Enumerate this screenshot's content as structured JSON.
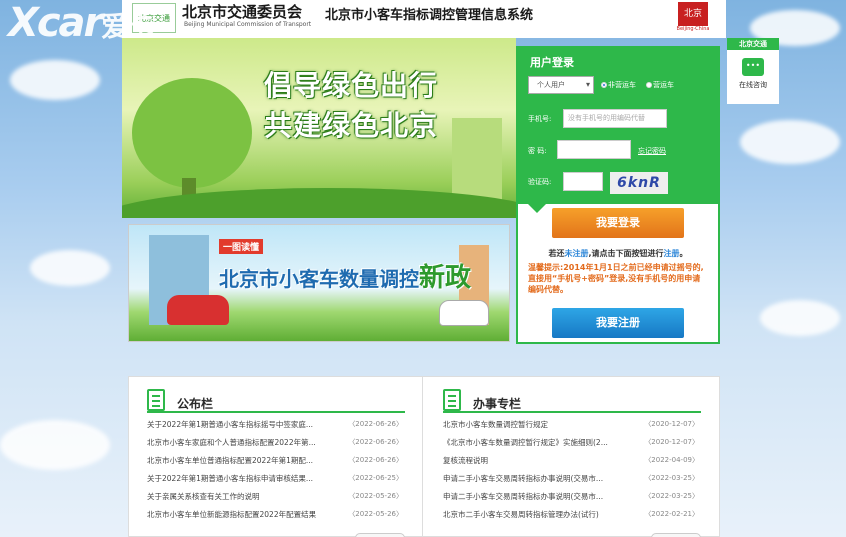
{
  "watermark": {
    "brand": "Xcar",
    "suffix": "爱卡"
  },
  "header": {
    "logo_text": "北京交通",
    "org_name": "北京市交通委员会",
    "org_name_en": "Beijing Municipal Commission of Transport",
    "system_title": "北京市小客车指标调控管理信息系统",
    "city_logo_text": "北京",
    "city_logo_sub": "Beijing·China"
  },
  "banner1": {
    "line1": "倡导绿色出行",
    "line2": "共建绿色北京"
  },
  "banner2": {
    "tag": "一图读懂",
    "headline_prefix": "北京市小客车数量调控",
    "headline_emphasis": "新政"
  },
  "login": {
    "title": "用户登录",
    "user_type": "个人用户",
    "radio_options": [
      "非营运车",
      "营运车"
    ],
    "phone_label": "手机号:",
    "phone_placeholder": "没有手机号的用编码代替",
    "password_label": "密  码:",
    "forgot_link": "忘记密码",
    "captcha_label": "验证码:",
    "captcha_text": "6knR",
    "login_button": "我要登录",
    "register_hint_1": "若还",
    "register_hint_link1": "未注册",
    "register_hint_2": ",请点击下面按钮进行",
    "register_hint_link2": "注册",
    "register_hint_3": "。",
    "warm_tip": "温馨提示:2014年1月1日之前已经申请过摇号的,直接用“手机号+密码”登录,没有手机号的用申请编码代替。",
    "register_button": "我要注册"
  },
  "service": {
    "title": "北京交通",
    "label": "在线咨询"
  },
  "board": {
    "notice": {
      "title": "公布栏",
      "items": [
        {
          "text": "关于2022年第1期普通小客车指标摇号中签家庭...",
          "date": "〈2022-06-26〉"
        },
        {
          "text": "北京市小客车家庭和个人普通指标配置2022年第...",
          "date": "〈2022-06-26〉"
        },
        {
          "text": "北京市小客车单位普通指标配置2022年第1期配...",
          "date": "〈2022-06-26〉"
        },
        {
          "text": "关于2022年第1期普通小客车指标申请审核结果...",
          "date": "〈2022-06-25〉"
        },
        {
          "text": "关于亲属关系核查有关工作的说明",
          "date": "〈2022-05-26〉"
        },
        {
          "text": "北京市小客车单位新能源指标配置2022年配置结果",
          "date": "〈2022-05-26〉"
        }
      ]
    },
    "affairs": {
      "title": "办事专栏",
      "items": [
        {
          "text": "北京市小客车数量调控暂行规定",
          "date": "〈2020-12-07〉"
        },
        {
          "text": "《北京市小客车数量调控暂行规定》实施细则(2...",
          "date": "〈2020-12-07〉"
        },
        {
          "text": "复核流程说明",
          "date": "〈2022-04-09〉"
        },
        {
          "text": "申请二手小客车交易周转指标办事说明(交易市...",
          "date": "〈2022-03-25〉"
        },
        {
          "text": "申请二手小客车交易周转指标办事说明(交易市...",
          "date": "〈2022-03-25〉"
        },
        {
          "text": "北京市二手小客车交易周转指标管理办法(试行)",
          "date": "〈2022-02-21〉"
        }
      ]
    }
  }
}
